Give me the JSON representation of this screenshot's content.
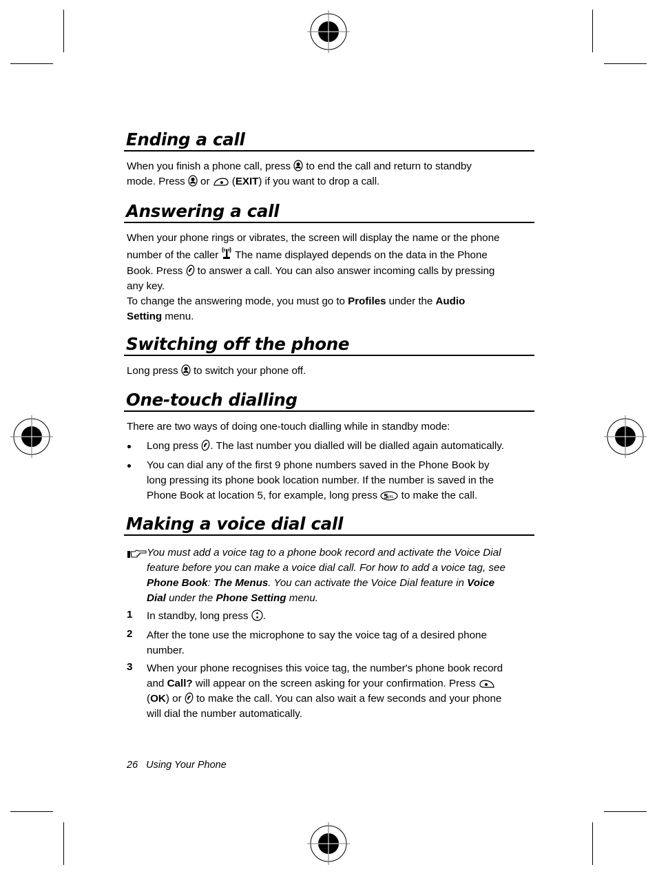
{
  "sections": [
    {
      "heading": "Ending a call",
      "para1_a": "When you finish a phone call, press ",
      "para1_b": " to end the call and return to standby",
      "para2_a": "mode. Press ",
      "para2_b": " or ",
      "para2_c": " (",
      "para2_exit": "EXIT",
      "para2_d": ") if you want to drop a call."
    },
    {
      "heading": "Answering a call",
      "l1": "When your phone rings or vibrates, the screen will display the name or the phone",
      "l2_a": "number of the caller ",
      "l2_b": " The name displayed depends on the data in the Phone",
      "l3_a": "Book. Press ",
      "l3_b": " to answer a call. You can also answer incoming calls by pressing",
      "l4": "any key.",
      "l5_a": "To change the answering mode, you must go to ",
      "l5_profiles": "Profiles",
      "l5_b": " under the ",
      "l5_audio": "Audio",
      "l6_setting": "Setting",
      "l6_b": " menu."
    },
    {
      "heading": "Switching off the phone",
      "l1_a": "Long press ",
      "l1_b": " to switch your phone off."
    },
    {
      "heading": "One-touch dialling",
      "intro": "There are two ways of doing one-touch dialling while in standby mode:",
      "bullets": [
        {
          "a": "Long press ",
          "b": ". The last number you dialled will be dialled again automatically."
        },
        {
          "l1": "You can dial any of the first 9 phone numbers saved in the Phone Book by",
          "l2": "long pressing its phone book location number. If the number is saved in the",
          "l3_a": "Phone Book at location 5, for example, long press ",
          "l3_b": " to make the call."
        }
      ]
    },
    {
      "heading": "Making a voice dial call",
      "note_l1": "You must add a voice tag to a phone book record and activate the Voice Dial",
      "note_l2": "feature before you can make a voice dial call. For how to add a voice tag, see",
      "note_l3_pb": "Phone Book",
      "note_l3_colon": ": ",
      "note_l3_menus": "The Menus",
      "note_l3_b": ". You can activate the Voice Dial feature in ",
      "note_l3_voice": "Voice",
      "note_l4_dial": "Dial",
      "note_l4_b": " under the ",
      "note_l4_ps": "Phone Setting",
      "note_l4_c": " menu.",
      "steps": [
        {
          "n": "1",
          "a": "In standby, long press ",
          "b": "."
        },
        {
          "n": "2",
          "l1": "After the tone use the microphone to say the voice tag of a desired phone",
          "l2": "number."
        },
        {
          "n": "3",
          "l1": "When your phone recognises this voice tag, the number's phone book record",
          "l2_a": "and ",
          "l2_call": "Call?",
          "l2_b": " will appear on the screen asking for your confirmation. Press ",
          "l3_a": "(",
          "l3_ok": "OK",
          "l3_b": ") or ",
          "l3_c": " to make the call. You can also wait a few seconds and your phone",
          "l4": "will dial the number automatically."
        }
      ]
    }
  ],
  "footer": {
    "page_number": "26",
    "chapter": "Using Your Phone"
  },
  "icons": {
    "end_key": "end-call-key",
    "exit_softkey": "right-softkey",
    "incoming_call": "incoming-call-antenna",
    "send_key": "send-call-key",
    "key_5": "key-5",
    "note": "pointing-hand-note",
    "nav_key": "up-down-navigation-key",
    "ok_softkey": "left-softkey"
  }
}
